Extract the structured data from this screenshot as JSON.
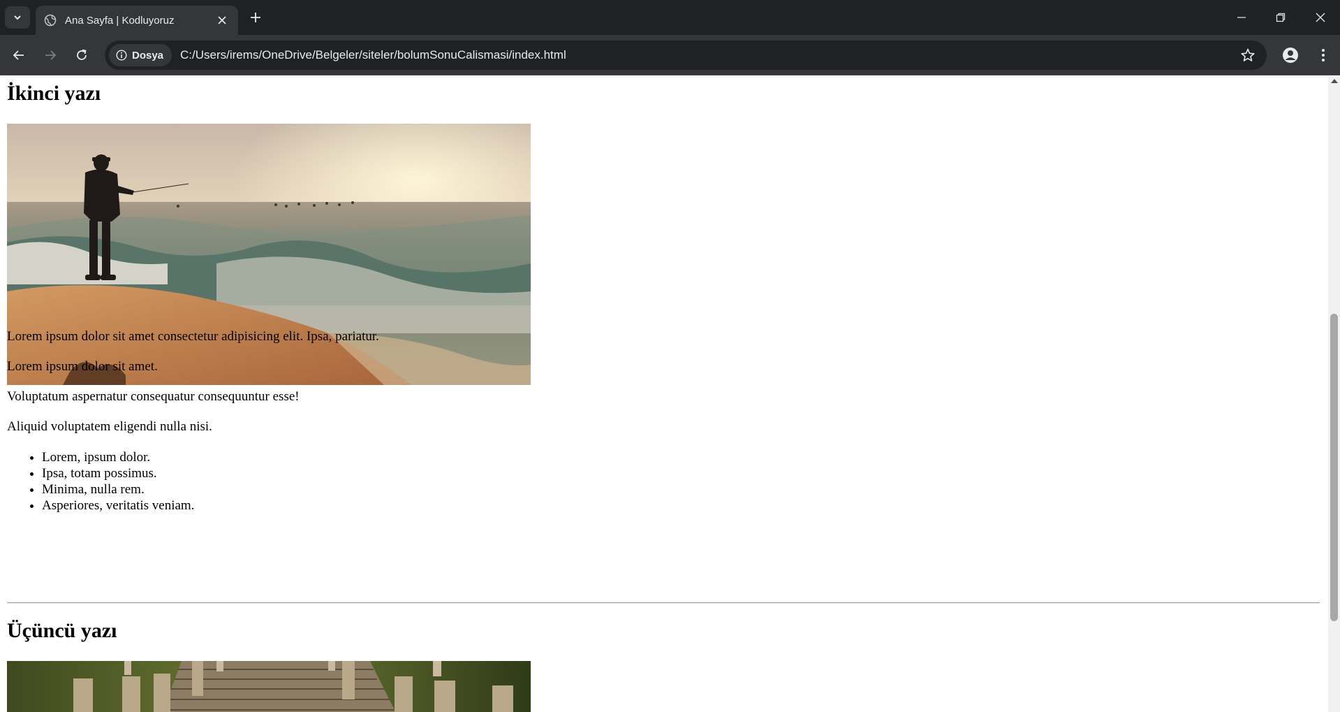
{
  "browser": {
    "tab_title": "Ana Sayfa | Kodluyoruz",
    "security_chip": "Dosya",
    "url": "C:/Users/irems/OneDrive/Belgeler/siteler/bolumSonuCalismasi/index.html",
    "icons": [
      "tab-search-icon",
      "globe-icon",
      "close-icon",
      "plus-icon",
      "minimize-icon",
      "restore-icon",
      "window-close-icon",
      "back-icon",
      "forward-icon",
      "reload-icon",
      "info-icon",
      "star-icon",
      "profile-icon",
      "menu-icon"
    ]
  },
  "page": {
    "post2": {
      "heading": "İkinci yazı",
      "image_desc": "sea-fisherman",
      "paragraphs": [
        "Lorem ipsum dolor sit amet consectetur adipisicing elit. Ipsa, pariatur.",
        "Lorem ipsum dolor sit amet.",
        "Voluptatum aspernatur consequatur consequuntur esse!",
        "Aliquid voluptatem eligendi nulla nisi."
      ],
      "list": [
        "Lorem, ipsum dolor.",
        "Ipsa, totam possimus.",
        "Minima, nulla rem.",
        "Asperiores, veritatis veniam."
      ]
    },
    "post3": {
      "heading": "Üçüncü yazı",
      "image_desc": "wooden-pier"
    }
  },
  "colors": {
    "chrome_dark": "#202124",
    "chrome_toolbar": "#35363a",
    "chrome_text": "#e8eaed"
  }
}
